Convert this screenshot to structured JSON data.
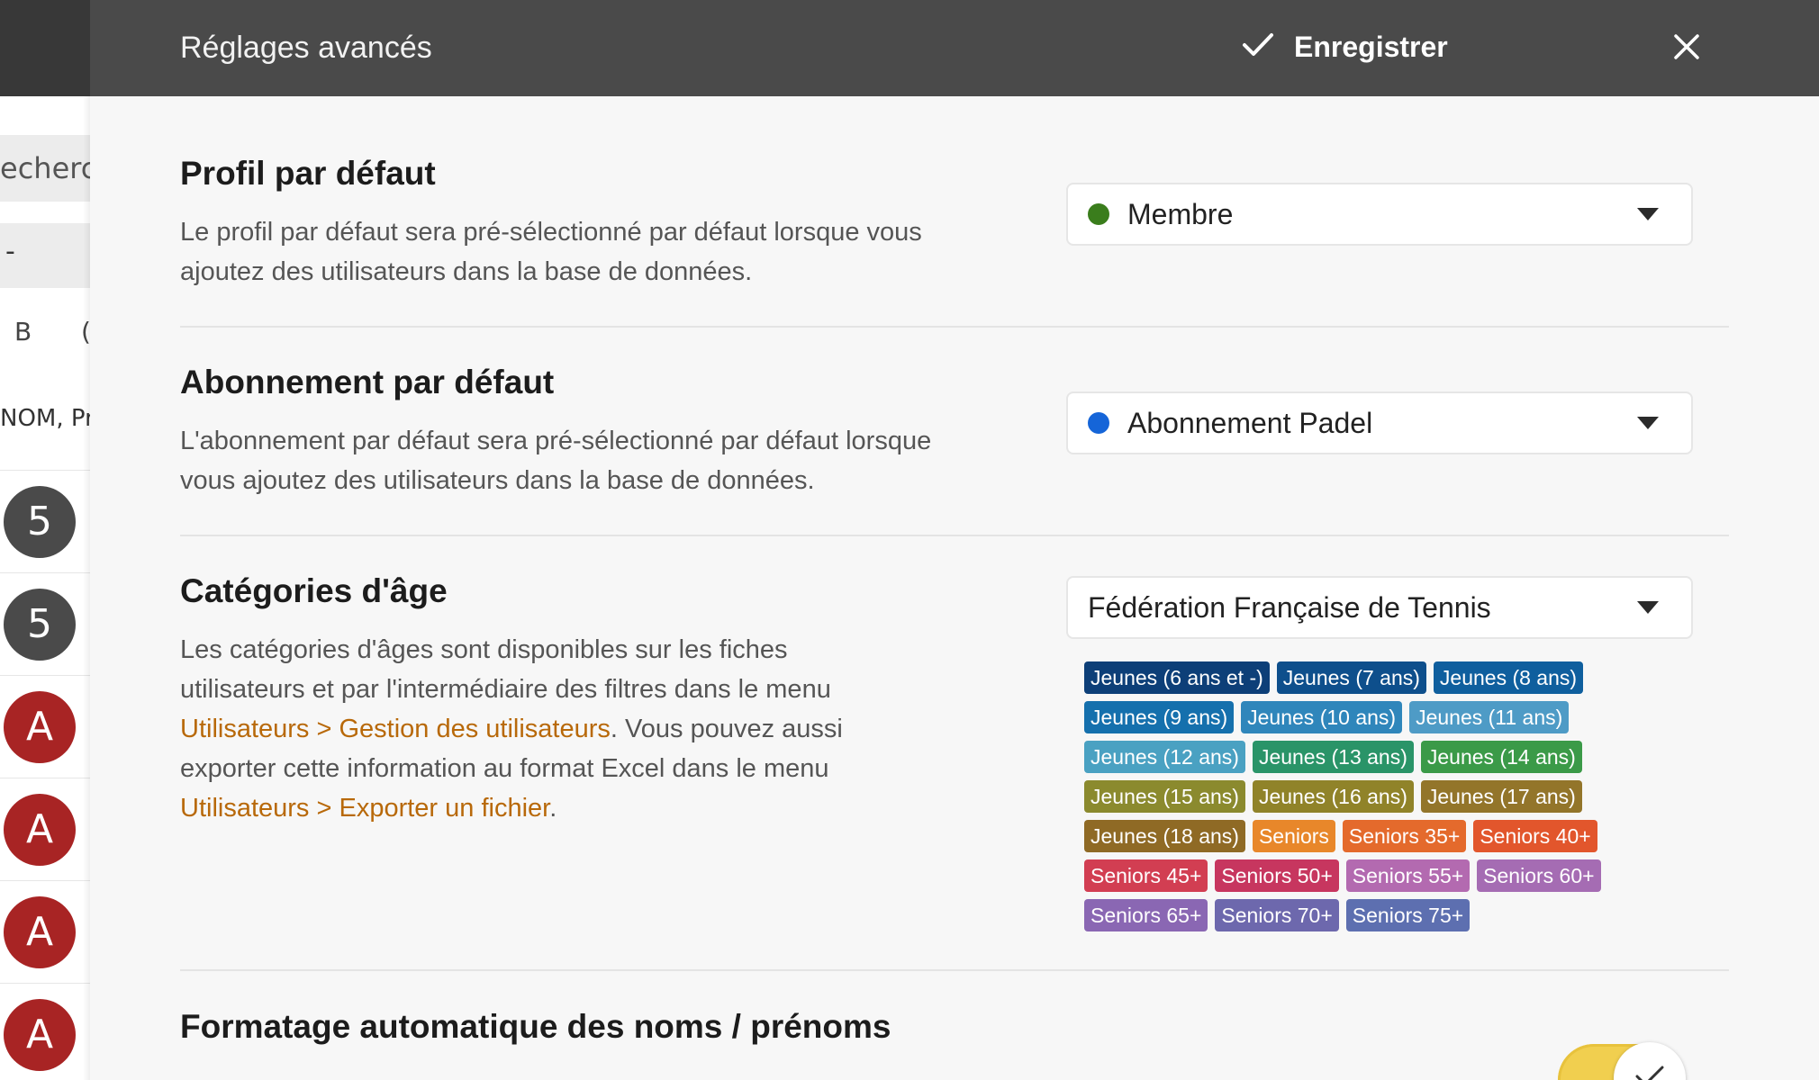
{
  "background": {
    "search_partial": "echercl",
    "filter_partial": "-",
    "letters": [
      "B",
      "("
    ],
    "column_header_partial": "NOM, Pr",
    "avatars": [
      {
        "letter": "5",
        "color": "#4a4a4a"
      },
      {
        "letter": "5",
        "color": "#4a4a4a"
      },
      {
        "letter": "A",
        "color": "#a82424"
      },
      {
        "letter": "A",
        "color": "#a82424"
      },
      {
        "letter": "A",
        "color": "#a82424"
      },
      {
        "letter": "A",
        "color": "#a82424"
      }
    ]
  },
  "header": {
    "title": "Réglages avancés",
    "save_label": "Enregistrer",
    "save_icon": "check-icon",
    "close_icon": "close-icon"
  },
  "profile": {
    "title": "Profil par défaut",
    "description": "Le profil par défaut sera pré-sélectionné par défaut lorsque vous ajoutez des utilisateurs dans la base de données.",
    "selected": "Membre",
    "dot_color": "#3a7d1c"
  },
  "subscription": {
    "title": "Abonnement par défaut",
    "description": "L'abonnement par défaut sera pré-sélectionné par défaut lorsque vous ajoutez des utilisateurs dans la base de données.",
    "selected": "Abonnement Padel",
    "dot_color": "#1565d8"
  },
  "age_categories": {
    "title": "Catégories d'âge",
    "desc_part1": "Les catégories d'âges sont disponibles sur les fiches utilisateurs et par l'intermédiaire des filtres dans le menu",
    "link1": "Utilisateurs > Gestion des utilisateurs",
    "desc_part2": ". Vous pouvez aussi exporter cette information au format Excel dans le menu",
    "link2": "Utilisateurs > Exporter un fichier",
    "desc_part3": ".",
    "selected": "Fédération Française de Tennis",
    "tag_rows": [
      [
        {
          "label": "Jeunes (6 ans et -)",
          "color": "#0d3f78"
        },
        {
          "label": "Jeunes (7 ans)",
          "color": "#0e4f8c"
        },
        {
          "label": "Jeunes (8 ans)",
          "color": "#0f5f9e"
        }
      ],
      [
        {
          "label": "Jeunes (9 ans)",
          "color": "#1570ad"
        },
        {
          "label": "Jeunes (10 ans)",
          "color": "#2f86bb"
        },
        {
          "label": "Jeunes (11 ans)",
          "color": "#4e9bc6"
        }
      ],
      [
        {
          "label": "Jeunes (12 ans)",
          "color": "#4aa1c2"
        },
        {
          "label": "Jeunes (13 ans)",
          "color": "#2a9468"
        },
        {
          "label": "Jeunes (14 ans)",
          "color": "#3b9a48"
        }
      ],
      [
        {
          "label": "Jeunes (15 ans)",
          "color": "#8b8a2e"
        },
        {
          "label": "Jeunes (16 ans)",
          "color": "#908329"
        },
        {
          "label": "Jeunes (17 ans)",
          "color": "#93752a"
        }
      ],
      [
        {
          "label": "Jeunes (18 ans)",
          "color": "#8f6a25"
        },
        {
          "label": "Seniors",
          "color": "#e8872a"
        },
        {
          "label": "Seniors 35+",
          "color": "#e46a2c"
        },
        {
          "label": "Seniors 40+",
          "color": "#e2562c"
        }
      ],
      [
        {
          "label": "Seniors 45+",
          "color": "#d23e52"
        },
        {
          "label": "Seniors 50+",
          "color": "#c7365f"
        },
        {
          "label": "Seniors 55+",
          "color": "#b36ab0"
        },
        {
          "label": "Seniors 60+",
          "color": "#a56cb3"
        }
      ],
      [
        {
          "label": "Seniors 65+",
          "color": "#8a67b3"
        },
        {
          "label": "Seniors 70+",
          "color": "#6d68ad"
        },
        {
          "label": "Seniors 75+",
          "color": "#5d6fb0"
        }
      ]
    ]
  },
  "name_format": {
    "title": "Formatage automatique des noms / prénoms",
    "toggle_on": true,
    "toggle_color": "#f1cf4f"
  }
}
